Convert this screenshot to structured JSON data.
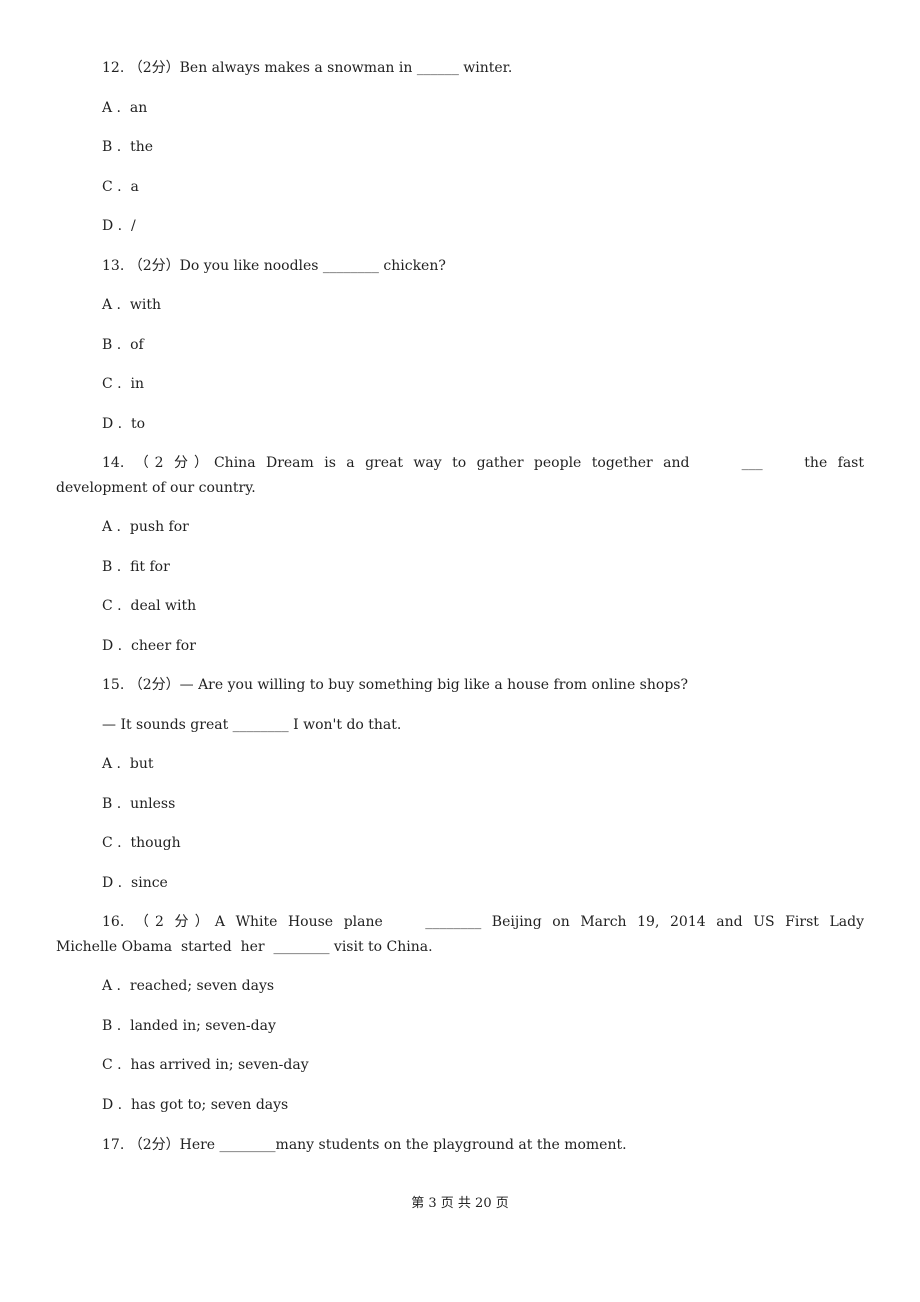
{
  "questions": [
    {
      "number": "12.",
      "score": "（2分）",
      "stem": "Ben always makes a snowman in ______ winter.",
      "options": [
        {
          "letter": "A",
          "text": "an"
        },
        {
          "letter": "B",
          "text": "the"
        },
        {
          "letter": "C",
          "text": "a"
        },
        {
          "letter": "D",
          "text": "/"
        }
      ]
    },
    {
      "number": "13.",
      "score": "（2分）",
      "stem": "Do you like noodles ________ chicken?",
      "options": [
        {
          "letter": "A",
          "text": "with"
        },
        {
          "letter": "B",
          "text": "of"
        },
        {
          "letter": "C",
          "text": "in"
        },
        {
          "letter": "D",
          "text": "to"
        }
      ]
    },
    {
      "number": "14.",
      "score": "（2 分）",
      "stem_line1": "China Dream is a great way to gather people together and     ___    the fast",
      "stem_line2": "development of our country.",
      "options": [
        {
          "letter": "A",
          "text": "push for"
        },
        {
          "letter": "B",
          "text": "fit for"
        },
        {
          "letter": "C",
          "text": "deal with"
        },
        {
          "letter": "D",
          "text": "cheer for"
        }
      ]
    },
    {
      "number": "15.",
      "score": "（2分）",
      "stem_line1": "— Are you willing to buy something big like a house from online shops?",
      "stem_line2": "— It sounds great ________ I won't do that.",
      "options": [
        {
          "letter": "A",
          "text": "but"
        },
        {
          "letter": "B",
          "text": "unless"
        },
        {
          "letter": "C",
          "text": "though"
        },
        {
          "letter": "D",
          "text": "since"
        }
      ]
    },
    {
      "number": "16.",
      "score": "（2 分）",
      "stem_line1": "A White House plane    ________ Beijing on March 19, 2014 and US First Lady",
      "stem_line2": "Michelle Obama  started  her  ________ visit to China.",
      "options": [
        {
          "letter": "A",
          "text": "reached; seven days"
        },
        {
          "letter": "B",
          "text": "landed in; seven-day"
        },
        {
          "letter": "C",
          "text": "has arrived in; seven-day"
        },
        {
          "letter": "D",
          "text": "has got to; seven days"
        }
      ]
    },
    {
      "number": "17.",
      "score": "（2分）",
      "stem": "Here ________many students on the playground at the moment."
    }
  ],
  "footer": "第 3 页 共 20 页"
}
